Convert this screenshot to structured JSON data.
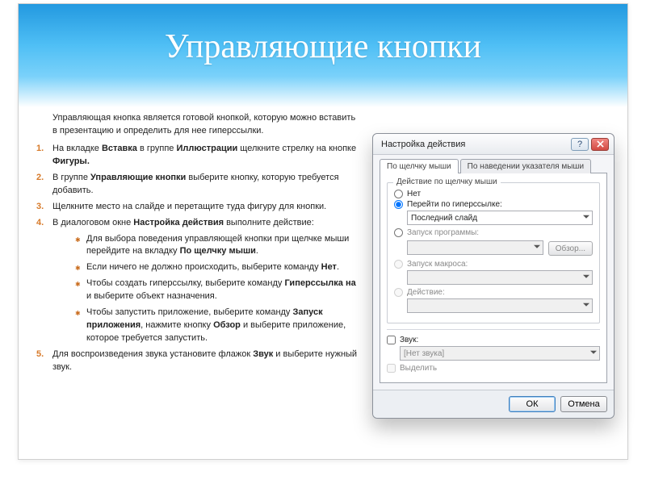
{
  "title": "Управляющие кнопки",
  "intro": "Управляющая кнопка является готовой кнопкой, которую можно вставить в презентацию и определить для нее гиперссылки.",
  "steps": [
    {
      "pre": "На вкладке ",
      "b1": "Вставка",
      "mid1": " в группе ",
      "b2": "Иллюстрации",
      "mid2": " щелкните стрелку на кнопке ",
      "b3": "Фигуры.",
      "tail": ""
    },
    {
      "pre": "В группе ",
      "b1": "Управляющие кнопки",
      "tail": " выберите кнопку, которую требуется добавить."
    },
    {
      "pre": "Щелкните место на слайде и перетащите туда фигуру для кнопки.",
      "b1": "",
      "tail": ""
    },
    {
      "pre": "В диалоговом окне ",
      "b1": "Настройка действия",
      "tail": " выполните действие:"
    },
    {
      "pre": "Для воспроизведения звука установите флажок ",
      "b1": "Звук",
      "tail": " и выберите нужный звук."
    }
  ],
  "bullets": [
    {
      "pre": "Для выбора поведения управляющей кнопки при щелчке мыши перейдите на вкладку ",
      "b1": "По щелчку мыши",
      "tail": "."
    },
    {
      "pre": "Если ничего не должно происходить, выберите команду ",
      "b1": "Нет",
      "tail": "."
    },
    {
      "pre": "Чтобы создать гиперссылку, выберите команду ",
      "b1": "Гиперссылка на",
      "tail": " и выберите объект назначения."
    },
    {
      "pre": "Чтобы запустить приложение, выберите команду ",
      "b1": "Запуск приложения",
      "mid1": ", нажмите кнопку ",
      "b2": "Обзор",
      "tail": " и выберите приложение, которое требуется запустить."
    }
  ],
  "dialog": {
    "title": "Настройка действия",
    "tabs": {
      "active": "По щелчку мыши",
      "inactive": "По наведении указателя мыши"
    },
    "group_title": "Действие по щелчку мыши",
    "opt_none": "Нет",
    "opt_hyperlink": "Перейти по гиперссылке:",
    "hyperlink_value": "Последний слайд",
    "opt_run_prog": "Запуск программы:",
    "browse_btn": "Обзор...",
    "opt_run_macro": "Запуск макроса:",
    "opt_action": "Действие:",
    "chk_sound": "Звук:",
    "sound_value": "[Нет звука]",
    "chk_highlight": "Выделить",
    "ok": "ОК",
    "cancel": "Отмена",
    "help_glyph": "?"
  }
}
